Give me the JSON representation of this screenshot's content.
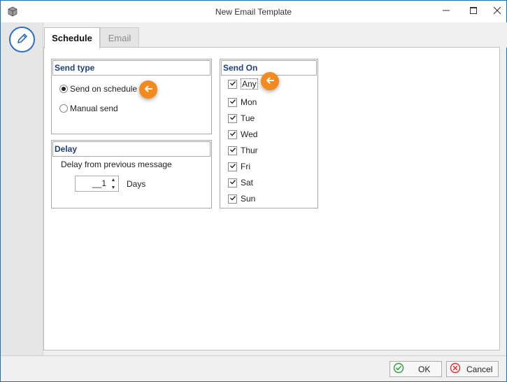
{
  "window": {
    "title": "New Email Template",
    "app_icon": "app-cube-icon",
    "controls": [
      "minimize-icon",
      "maximize-icon",
      "close-icon"
    ]
  },
  "sidebar": {
    "icon": "edit-pencil-icon"
  },
  "tabs": [
    {
      "label": "Schedule",
      "active": true
    },
    {
      "label": "Email",
      "active": false
    }
  ],
  "send_type": {
    "header": "Send type",
    "options": [
      {
        "label": "Send on schedule",
        "selected": true
      },
      {
        "label": "Manual send",
        "selected": false
      }
    ]
  },
  "delay": {
    "header": "Delay",
    "label": "Delay from previous message",
    "value": "__1",
    "unit": "Days"
  },
  "send_on": {
    "header": "Send On",
    "days": [
      {
        "label": "Any",
        "checked": true
      },
      {
        "label": "Mon",
        "checked": true
      },
      {
        "label": "Tue",
        "checked": true
      },
      {
        "label": "Wed",
        "checked": true
      },
      {
        "label": "Thur",
        "checked": true
      },
      {
        "label": "Fri",
        "checked": true
      },
      {
        "label": "Sat",
        "checked": true
      },
      {
        "label": "Sun",
        "checked": true
      }
    ]
  },
  "footer": {
    "ok_label": "OK",
    "cancel_label": "Cancel"
  },
  "colors": {
    "accent": "#2c6fbd",
    "group_header": "#1f3f7a",
    "hint": "#f28a1e",
    "ok_icon": "#2e9e3b",
    "cancel_icon": "#d9332c"
  }
}
